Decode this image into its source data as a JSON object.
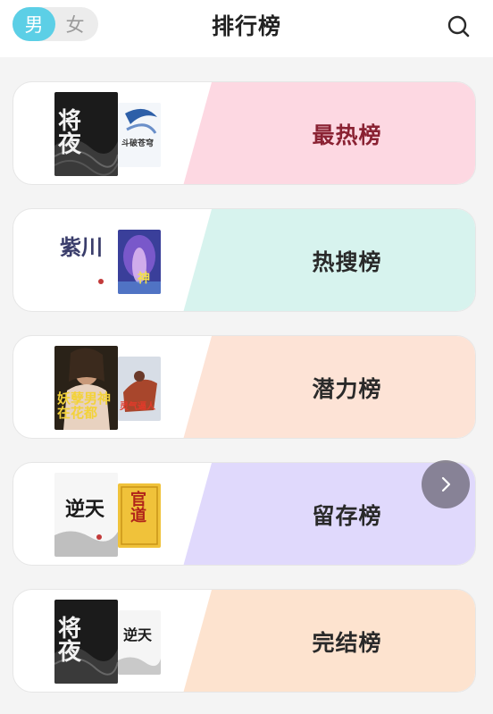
{
  "header": {
    "title": "排行榜",
    "gender_male": "男",
    "gender_female": "女",
    "search_icon": "search-icon"
  },
  "colors": {
    "accent": "#5ccfe6",
    "hot_bg": "#fdd8e2",
    "search_bg": "#d7f3ee",
    "potential_bg": "#fde3d6",
    "retention_bg": "#e0d9fc",
    "complete_bg": "#fde3cf"
  },
  "ranks": [
    {
      "label": "最热榜",
      "cover_front": "将夜",
      "cover_back": "斗破苍穹"
    },
    {
      "label": "热搜榜",
      "cover_front": "紫川",
      "cover_back": "神"
    },
    {
      "label": "潜力榜",
      "cover_front": "妖孽男神在花都",
      "cover_back": "灵气逼人"
    },
    {
      "label": "留存榜",
      "cover_front": "逆天",
      "cover_back": "官道"
    },
    {
      "label": "完结榜",
      "cover_front": "将夜",
      "cover_back": "逆天"
    }
  ],
  "next_button_icon": "chevron-right-icon"
}
